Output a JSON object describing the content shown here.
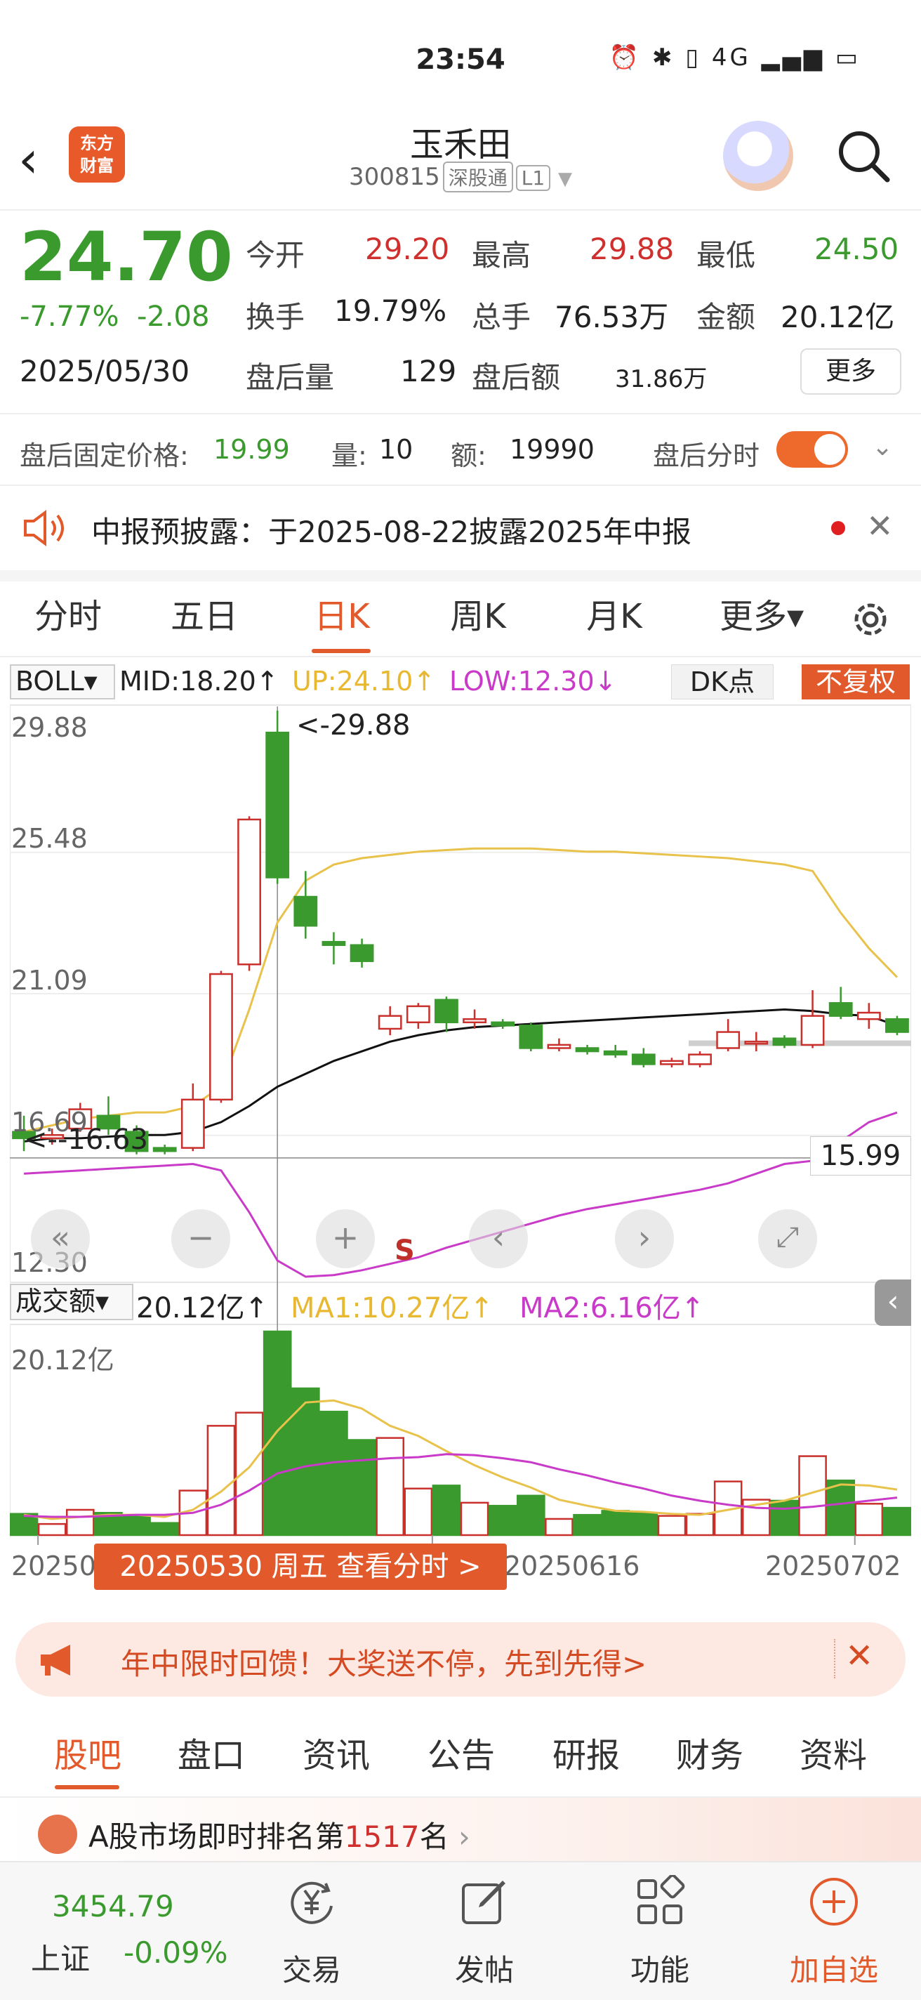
{
  "status": {
    "time": "23:54",
    "icons": "⏰ ✱ ▯ 4G ▂▄▆ ▭"
  },
  "header": {
    "title": "玉禾田",
    "code": "300815",
    "tag1": "深股通",
    "tag2": "L1",
    "logo_l1": "东方",
    "logo_l2": "财富"
  },
  "quote": {
    "price": "24.70",
    "pct": "-7.77%",
    "chg": "-2.08",
    "date": "2025/05/30",
    "open_label": "今开",
    "open": "29.20",
    "high_label": "最高",
    "high": "29.88",
    "low_label": "最低",
    "low": "24.50",
    "turnover_label": "换手",
    "turnover": "19.79%",
    "vol_label": "总手",
    "vol": "76.53万",
    "amt_label": "金额",
    "amt": "20.12亿",
    "after_vol_label": "盘后量",
    "after_vol": "129",
    "after_amt_label": "盘后额",
    "after_amt": "31.86万",
    "more": "更多"
  },
  "after_hours": {
    "fixed_label": "盘后固定价格:",
    "fixed": "19.99",
    "qty_label": "量:",
    "qty": "10",
    "amt_label": "额:",
    "amt": "19990",
    "fenshi_label": "盘后分时"
  },
  "notice": {
    "text": "中报预披露：于2025-08-22披露2025年中报"
  },
  "tabs": [
    "分时",
    "五日",
    "日K",
    "周K",
    "月K",
    "更多▾"
  ],
  "kline": {
    "indicator": "BOLL▾",
    "mid": "MID:18.20↑",
    "up": "UP:24.10↑",
    "low": "LOW:12.30↓",
    "dk": "DK点",
    "fq": "不复权",
    "axis": [
      "29.88",
      "25.48",
      "21.09",
      "16.69",
      "12.30"
    ],
    "max_label": "<-29.88",
    "min_label": "<--16.63",
    "cursor_price": "15.99",
    "signal": "S",
    "vol_indicator": "成交额▾",
    "vol_value": "20.12亿↑",
    "ma1": "MA1:10.27亿↑",
    "ma2": "MA2:6.16亿↑",
    "vol_axis": "20.12亿",
    "date_left": "20250",
    "date_mid": "20250616",
    "date_right": "20250702",
    "tip": "20250530 周五 查看分时 >"
  },
  "chart_data": {
    "type": "candlestick",
    "ylim": [
      12.3,
      29.88
    ],
    "candles": [
      {
        "o": 16.8,
        "c": 16.6,
        "h": 17.3,
        "l": 16.2
      },
      {
        "o": 16.6,
        "c": 16.7,
        "h": 16.9,
        "l": 16.4
      },
      {
        "o": 16.9,
        "c": 17.5,
        "h": 17.7,
        "l": 16.8
      },
      {
        "o": 17.3,
        "c": 16.9,
        "h": 17.9,
        "l": 16.7
      },
      {
        "o": 16.8,
        "c": 16.2,
        "h": 17.0,
        "l": 16.1
      },
      {
        "o": 16.3,
        "c": 16.2,
        "h": 16.4,
        "l": 16.1
      },
      {
        "o": 16.3,
        "c": 17.8,
        "h": 18.3,
        "l": 16.2
      },
      {
        "o": 17.8,
        "c": 21.7,
        "h": 21.8,
        "l": 17.7
      },
      {
        "o": 22.0,
        "c": 26.5,
        "h": 26.6,
        "l": 21.8
      },
      {
        "o": 29.2,
        "c": 24.7,
        "h": 29.88,
        "l": 24.5
      },
      {
        "o": 24.1,
        "c": 23.2,
        "h": 24.9,
        "l": 22.8
      },
      {
        "o": 22.7,
        "c": 22.6,
        "h": 23.0,
        "l": 22.0
      },
      {
        "o": 22.6,
        "c": 22.1,
        "h": 22.8,
        "l": 21.9
      },
      {
        "o": 20.0,
        "c": 20.4,
        "h": 20.7,
        "l": 19.8
      },
      {
        "o": 20.2,
        "c": 20.7,
        "h": 20.8,
        "l": 20.0
      },
      {
        "o": 20.9,
        "c": 20.2,
        "h": 21.0,
        "l": 19.9
      },
      {
        "o": 20.2,
        "c": 20.3,
        "h": 20.6,
        "l": 20.0
      },
      {
        "o": 20.2,
        "c": 20.1,
        "h": 20.3,
        "l": 20.0
      },
      {
        "o": 20.1,
        "c": 19.4,
        "h": 20.2,
        "l": 19.3
      },
      {
        "o": 19.4,
        "c": 19.5,
        "h": 19.7,
        "l": 19.3
      },
      {
        "o": 19.4,
        "c": 19.3,
        "h": 19.5,
        "l": 19.2
      },
      {
        "o": 19.3,
        "c": 19.2,
        "h": 19.5,
        "l": 19.1
      },
      {
        "o": 19.2,
        "c": 18.9,
        "h": 19.4,
        "l": 18.8
      },
      {
        "o": 18.9,
        "c": 19.0,
        "h": 19.1,
        "l": 18.8
      },
      {
        "o": 18.9,
        "c": 19.2,
        "h": 19.3,
        "l": 18.8
      },
      {
        "o": 19.4,
        "c": 19.9,
        "h": 20.3,
        "l": 19.3
      },
      {
        "o": 19.6,
        "c": 19.6,
        "h": 19.9,
        "l": 19.3
      },
      {
        "o": 19.7,
        "c": 19.5,
        "h": 19.8,
        "l": 19.4
      },
      {
        "o": 19.5,
        "c": 20.4,
        "h": 21.2,
        "l": 19.4
      },
      {
        "o": 20.8,
        "c": 20.4,
        "h": 21.3,
        "l": 20.3
      },
      {
        "o": 20.3,
        "c": 20.5,
        "h": 20.8,
        "l": 20.0
      },
      {
        "o": 20.3,
        "c": 19.9,
        "h": 20.4,
        "l": 19.8
      }
    ],
    "boll_up": [
      16.8,
      17.0,
      17.2,
      17.3,
      17.4,
      17.4,
      17.6,
      18.2,
      20.6,
      23.3,
      24.6,
      25.1,
      25.3,
      25.4,
      25.5,
      25.55,
      25.6,
      25.6,
      25.6,
      25.55,
      25.5,
      25.5,
      25.45,
      25.4,
      25.35,
      25.3,
      25.2,
      25.1,
      24.9,
      23.6,
      22.5,
      21.6
    ],
    "boll_mid": [
      16.5,
      16.6,
      16.6,
      16.65,
      16.7,
      16.7,
      16.8,
      17.1,
      17.6,
      18.2,
      18.6,
      19.0,
      19.3,
      19.6,
      19.8,
      19.95,
      20.05,
      20.1,
      20.15,
      20.2,
      20.25,
      20.3,
      20.35,
      20.4,
      20.45,
      20.5,
      20.55,
      20.6,
      20.55,
      20.45,
      20.4,
      20.1
    ],
    "boll_low": [
      15.5,
      15.55,
      15.6,
      15.65,
      15.7,
      15.75,
      15.8,
      15.6,
      14.3,
      12.8,
      12.3,
      12.35,
      12.5,
      12.7,
      12.9,
      13.2,
      13.45,
      13.7,
      13.95,
      14.2,
      14.4,
      14.55,
      14.7,
      14.85,
      15.0,
      15.2,
      15.5,
      15.8,
      15.9,
      16.5,
      17.1,
      17.4
    ],
    "volume": [
      2.1,
      1.1,
      2.5,
      2.2,
      2.0,
      1.2,
      4.4,
      10.8,
      12.1,
      20.12,
      14.5,
      12.2,
      9.4,
      9.6,
      4.6,
      4.9,
      3.2,
      2.9,
      3.9,
      1.6,
      2.0,
      2.4,
      2.2,
      1.9,
      2.1,
      5.3,
      3.5,
      3.4,
      7.8,
      5.4,
      3.1,
      2.7
    ],
    "vol_ma1": [
      2.0,
      1.6,
      1.8,
      2.0,
      2.0,
      1.8,
      2.5,
      4.3,
      6.7,
      10.3,
      13.1,
      13.3,
      12.5,
      10.8,
      9.8,
      8.3,
      6.9,
      5.7,
      4.7,
      3.5,
      2.9,
      2.4,
      2.3,
      2.1,
      2.0,
      2.5,
      3.0,
      3.4,
      4.2,
      5.0,
      4.9,
      4.5
    ],
    "vol_ma2": [
      1.9,
      1.8,
      1.8,
      1.9,
      2.0,
      2.0,
      2.2,
      3.0,
      4.4,
      6.1,
      6.8,
      7.2,
      7.4,
      7.6,
      7.7,
      8.0,
      7.9,
      7.6,
      7.2,
      6.5,
      5.9,
      5.2,
      4.6,
      3.9,
      3.4,
      3.0,
      2.7,
      2.6,
      2.8,
      3.1,
      3.4,
      3.7
    ]
  },
  "banner": {
    "text": "年中限时回馈！大奖送不停，先到先得>"
  },
  "sub_tabs": [
    "股吧",
    "盘口",
    "资讯",
    "公告",
    "研报",
    "财务",
    "资料"
  ],
  "feed": {
    "prefix": "A股市场即时排名第",
    "rank": "1517",
    "suffix": "名"
  },
  "bottom": {
    "index_value": "3454.79",
    "index_name": "上证",
    "index_pct": "-0.09%",
    "nav": [
      "交易",
      "发帖",
      "功能",
      "加自选"
    ]
  }
}
